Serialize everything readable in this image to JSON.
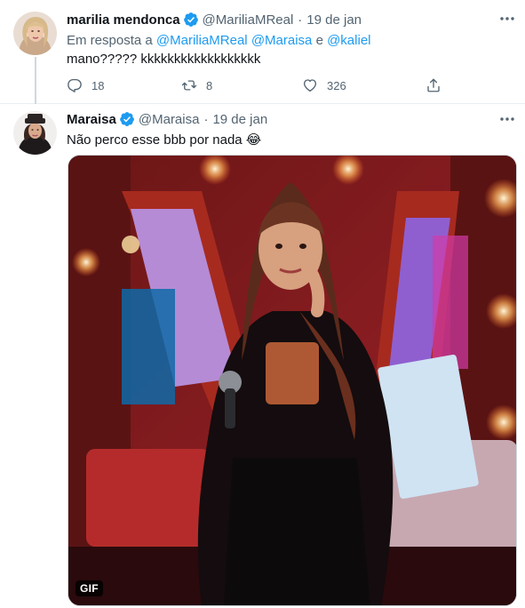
{
  "tweets": [
    {
      "author": "marilia mendonca",
      "handle": "@MariliaMReal",
      "separator": "·",
      "date": "19 de jan",
      "reply_prefix": "Em resposta a",
      "reply_to": [
        "@MariliaMReal",
        "@Maraisa"
      ],
      "reply_conjunction": "e",
      "reply_last": "@kaliel",
      "text": "mano????? kkkkkkkkkkkkkkkkkk",
      "replies": "18",
      "retweets": "8",
      "likes": "326"
    },
    {
      "author": "Maraisa",
      "handle": "@Maraisa",
      "separator": "·",
      "date": "19 de jan",
      "text": "Não perco esse bbb por nada 😂",
      "media_badge": "GIF"
    }
  ],
  "icons": {
    "verified": "verified-badge-icon",
    "more": "more-horizontal-icon",
    "reply": "reply-icon",
    "retweet": "retweet-icon",
    "like": "heart-icon",
    "share": "share-icon"
  },
  "colors": {
    "accent": "#1d9bf0",
    "secondary_text": "#536471",
    "primary_text": "#0f1419",
    "divider": "#ebeef0"
  }
}
